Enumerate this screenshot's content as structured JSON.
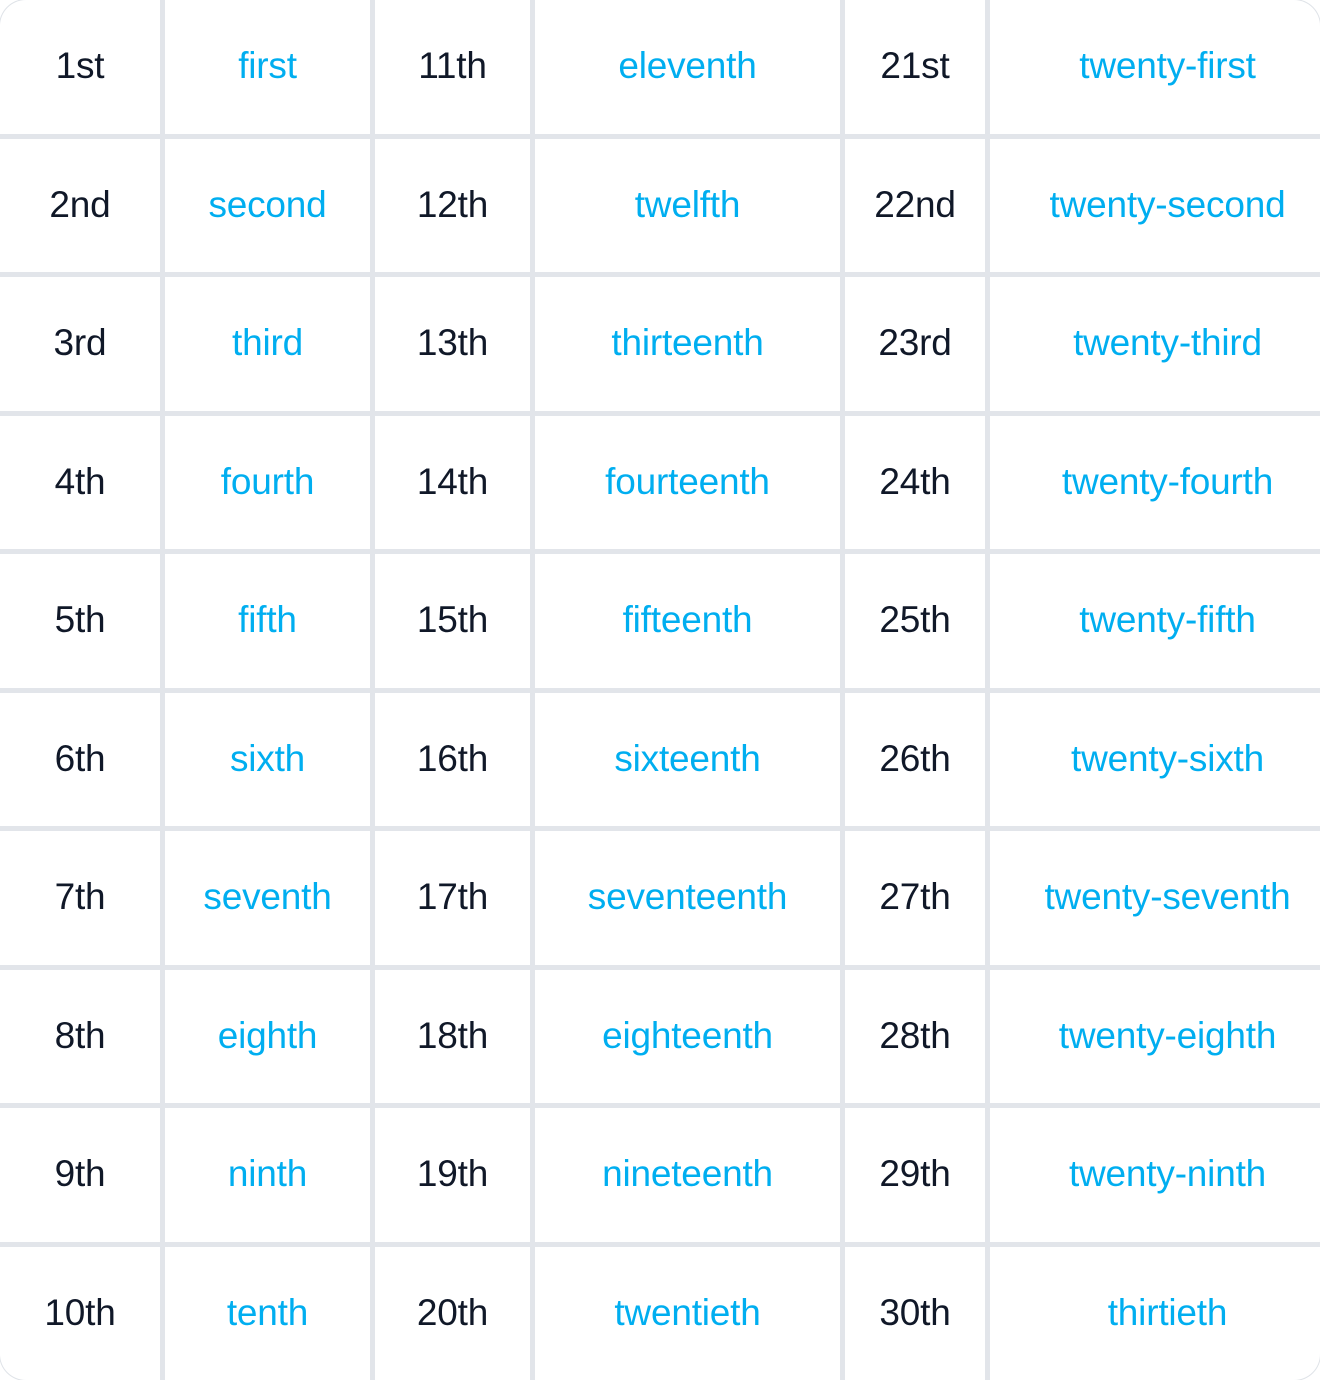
{
  "table": {
    "columns": 6,
    "rows": 10,
    "colors": {
      "numeral_text": "#101828",
      "word_text": "#00AEF0",
      "cell_background": "#FFFFFF",
      "grid_line": "#E2E5EA"
    },
    "column_kinds": [
      "numeral",
      "word",
      "numeral",
      "word",
      "numeral",
      "word"
    ],
    "cells": [
      [
        "1st",
        "first",
        "11th",
        "eleventh",
        "21st",
        "twenty-first"
      ],
      [
        "2nd",
        "second",
        "12th",
        "twelfth",
        "22nd",
        "twenty-second"
      ],
      [
        "3rd",
        "third",
        "13th",
        "thirteenth",
        "23rd",
        "twenty-third"
      ],
      [
        "4th",
        "fourth",
        "14th",
        "fourteenth",
        "24th",
        "twenty-fourth"
      ],
      [
        "5th",
        "fifth",
        "15th",
        "fifteenth",
        "25th",
        "twenty-fifth"
      ],
      [
        "6th",
        "sixth",
        "16th",
        "sixteenth",
        "26th",
        "twenty-sixth"
      ],
      [
        "7th",
        "seventh",
        "17th",
        "seventeenth",
        "27th",
        "twenty-seventh"
      ],
      [
        "8th",
        "eighth",
        "18th",
        "eighteenth",
        "28th",
        "twenty-eighth"
      ],
      [
        "9th",
        "ninth",
        "19th",
        "nineteenth",
        "29th",
        "twenty-ninth"
      ],
      [
        "10th",
        "tenth",
        "20th",
        "twentieth",
        "30th",
        "thirtieth"
      ]
    ]
  }
}
